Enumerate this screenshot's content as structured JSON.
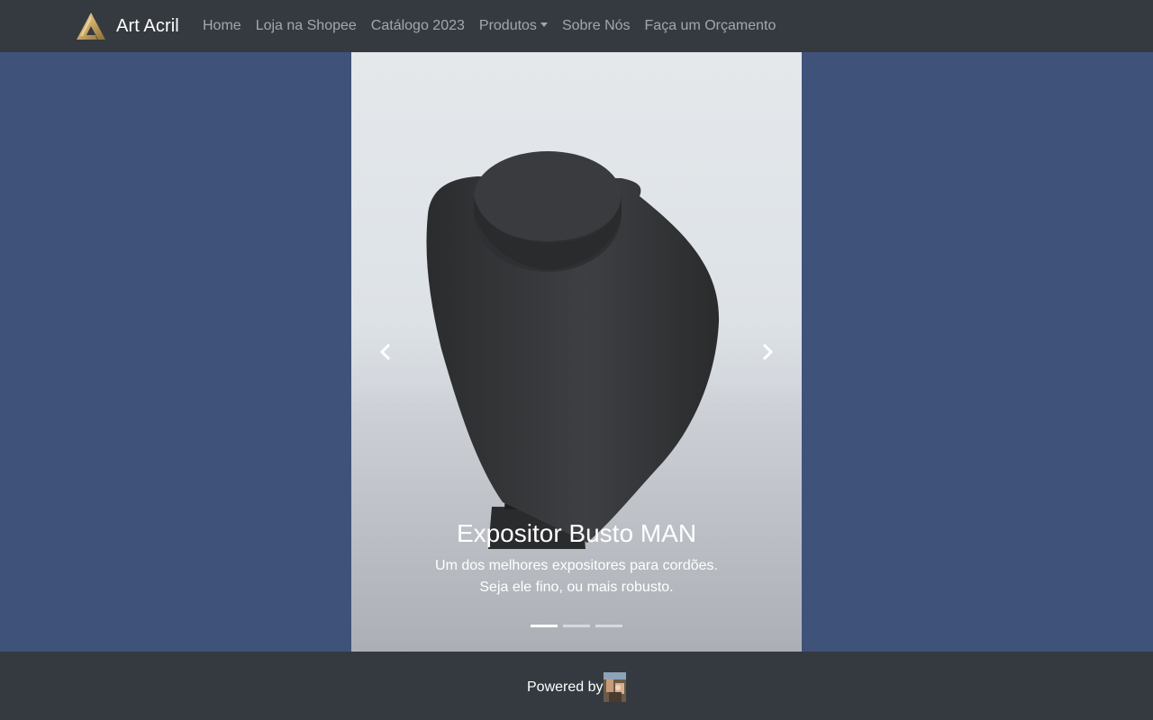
{
  "navbar": {
    "brand": "Art Acril",
    "items": [
      {
        "label": "Home"
      },
      {
        "label": "Loja na Shopee"
      },
      {
        "label": "Catálogo 2023"
      },
      {
        "label": "Produtos",
        "dropdown": true
      },
      {
        "label": "Sobre Nós"
      },
      {
        "label": "Faça um Orçamento"
      }
    ],
    "brand_color": "#c9a766"
  },
  "carousel": {
    "slide_title": "Expositor Busto MAN",
    "slide_text_line1": "Um dos melhores expositores para cordões.",
    "slide_text_line2": "Seja ele fino, ou mais robusto.",
    "indicator_count": 3,
    "active_index": 0,
    "prev_icon": "chevron-left-icon",
    "next_icon": "chevron-right-icon"
  },
  "footer": {
    "powered_by": "Powered by"
  },
  "colors": {
    "page_background": "#3f527a",
    "navbar_background": "#343a40"
  }
}
